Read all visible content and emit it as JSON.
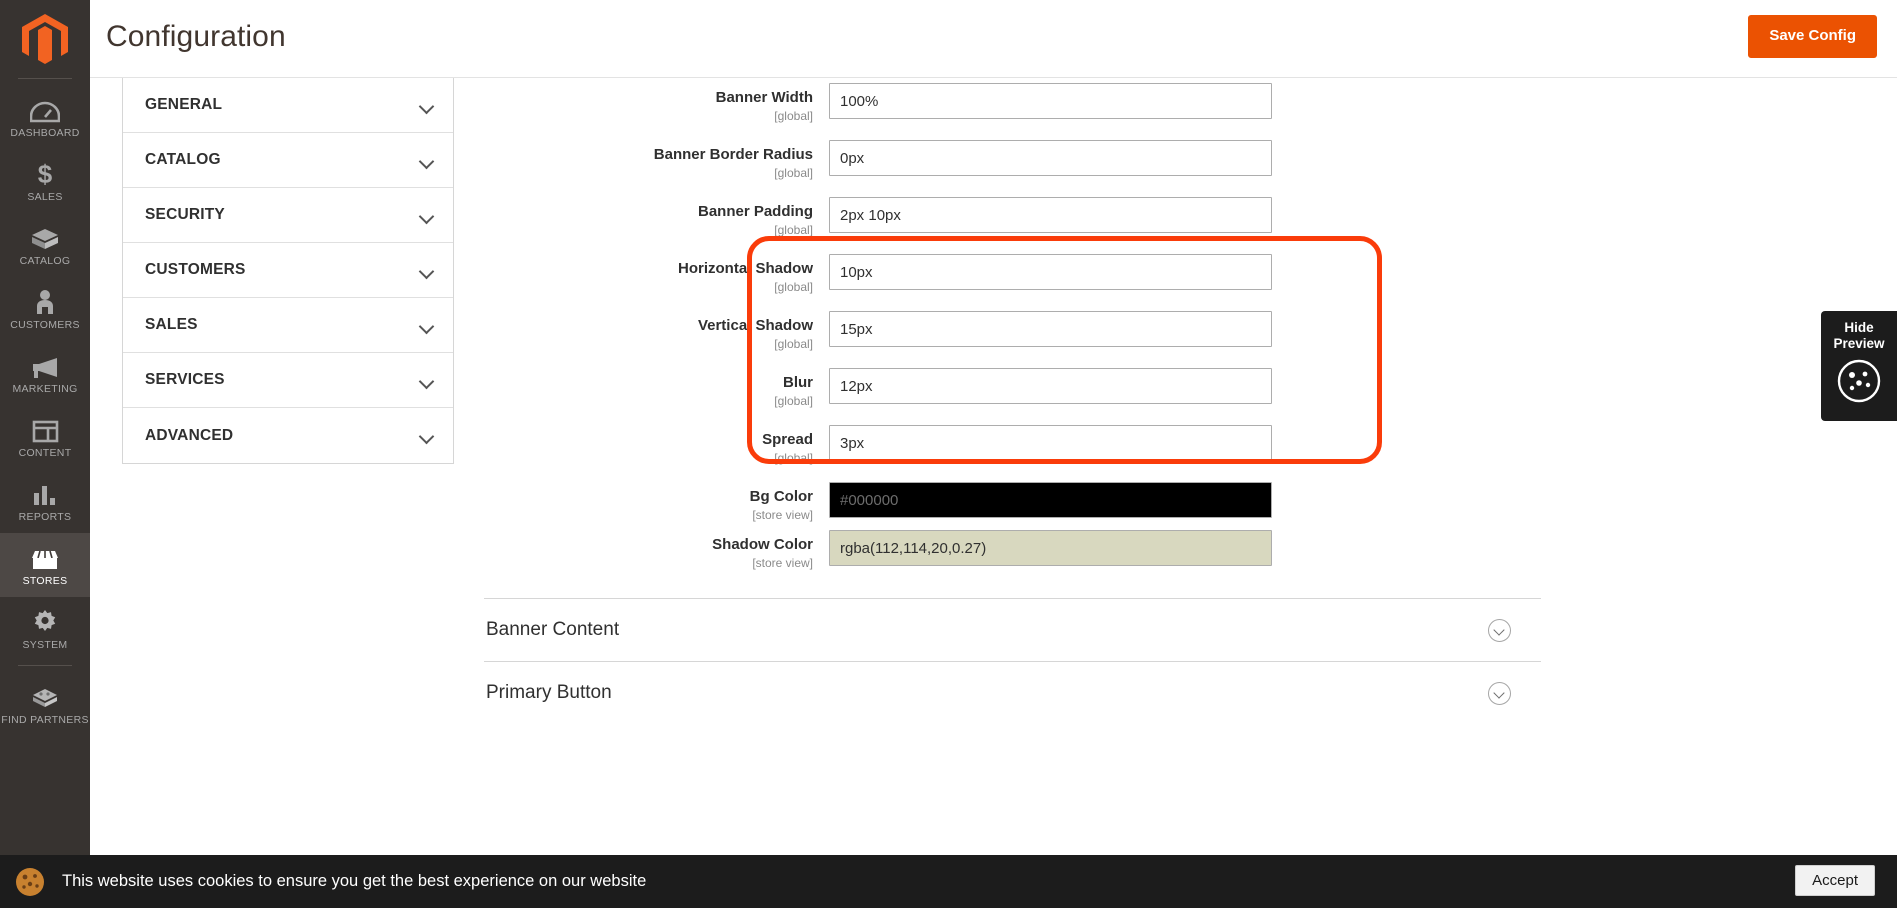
{
  "rail": {
    "logo_icon": "magento-logo-icon",
    "items": [
      {
        "label": "DASHBOARD",
        "icon": "dashboard-gauge-icon",
        "active": false
      },
      {
        "label": "SALES",
        "icon": "dollar-sign-icon",
        "active": false
      },
      {
        "label": "CATALOG",
        "icon": "box-icon",
        "active": false
      },
      {
        "label": "CUSTOMERS",
        "icon": "person-icon",
        "active": false
      },
      {
        "label": "MARKETING",
        "icon": "megaphone-icon",
        "active": false
      },
      {
        "label": "CONTENT",
        "icon": "layout-panel-icon",
        "active": false
      },
      {
        "label": "REPORTS",
        "icon": "bar-chart-icon",
        "active": false
      },
      {
        "label": "STORES",
        "icon": "storefront-icon",
        "active": true
      },
      {
        "label": "SYSTEM",
        "icon": "gear-icon",
        "active": false
      },
      {
        "label": "FIND PARTNERS",
        "icon": "extension-block-icon",
        "active": false
      }
    ]
  },
  "header": {
    "title": "Configuration",
    "save_label": "Save Config"
  },
  "config_nav": {
    "items": [
      {
        "label": "GENERAL",
        "icon": "chevron-down-icon"
      },
      {
        "label": "CATALOG",
        "icon": "chevron-down-icon"
      },
      {
        "label": "SECURITY",
        "icon": "chevron-down-icon"
      },
      {
        "label": "CUSTOMERS",
        "icon": "chevron-down-icon"
      },
      {
        "label": "SALES",
        "icon": "chevron-down-icon"
      },
      {
        "label": "SERVICES",
        "icon": "chevron-down-icon"
      },
      {
        "label": "ADVANCED",
        "icon": "chevron-down-icon"
      }
    ]
  },
  "form": {
    "fields": [
      {
        "label": "Banner Width",
        "scope": "[global]",
        "value": "100%",
        "style": "plain"
      },
      {
        "label": "Banner Border Radius",
        "scope": "[global]",
        "value": "0px",
        "style": "plain"
      },
      {
        "label": "Banner Padding",
        "scope": "[global]",
        "value": "2px 10px",
        "style": "plain"
      },
      {
        "label": "Horizontal Shadow",
        "scope": "[global]",
        "value": "10px",
        "style": "plain"
      },
      {
        "label": "Vertical Shadow",
        "scope": "[global]",
        "value": "15px",
        "style": "plain"
      },
      {
        "label": "Blur",
        "scope": "[global]",
        "value": "12px",
        "style": "plain"
      },
      {
        "label": "Spread",
        "scope": "[global]",
        "value": "3px",
        "style": "plain"
      },
      {
        "label": "Bg Color",
        "scope": "[store view]",
        "value": "#000000",
        "style": "swatch-dark"
      },
      {
        "label": "Shadow Color",
        "scope": "[store view]",
        "value": "rgba(112,114,20,0.27)",
        "style": "swatch-khaki"
      }
    ]
  },
  "sections": [
    {
      "title": "Banner Content",
      "icon": "chevron-down-circle-icon"
    },
    {
      "title": "Primary Button",
      "icon": "chevron-down-circle-icon"
    }
  ],
  "annotation": {
    "color": "#fa3c0a"
  },
  "preview_widget": {
    "line1": "Hide",
    "line2": "Preview",
    "icon": "cookie-icon"
  },
  "cookie_bar": {
    "message": "This website uses cookies to ensure you get the best experience on our website",
    "accept_label": "Accept",
    "icon": "cookie-icon"
  }
}
